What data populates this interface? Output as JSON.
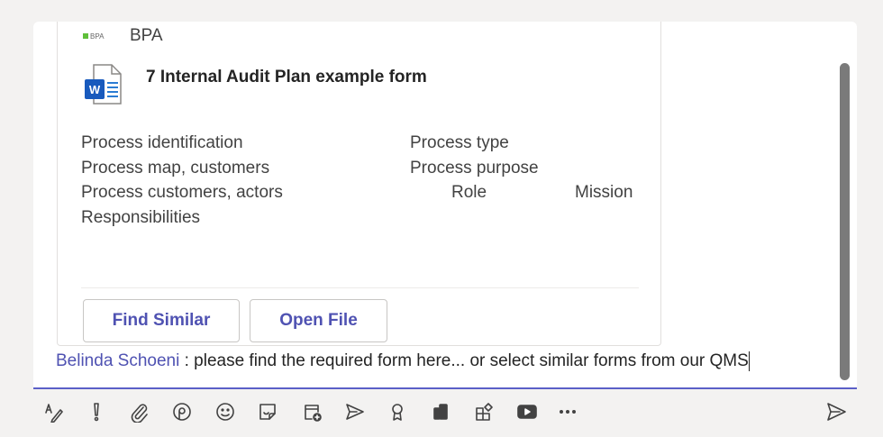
{
  "card": {
    "brand_logo_text": "BPA",
    "brand_name": "BPA",
    "document_title": "7 Internal Audit Plan example form",
    "fields": [
      "Process identification",
      "Process type",
      "Process map, customers",
      "Process purpose",
      "Process customers, actors",
      "Role",
      "Mission",
      "Responsibilities"
    ],
    "buttons": {
      "find_similar": "Find Similar",
      "open_file": "Open File"
    }
  },
  "message": {
    "mention": "Belinda Schoeni",
    "text": " : please find the required form here... or select similar forms from our QMS"
  },
  "toolbar": {
    "icons": [
      "format-icon",
      "important-icon",
      "attach-icon",
      "loop-icon",
      "emoji-icon",
      "sticker-icon",
      "schedule-meeting-icon",
      "praise-send-icon",
      "praise-icon",
      "app-icon",
      "apps-icon",
      "youtube-icon",
      "more-icon",
      "send-icon"
    ]
  },
  "colors": {
    "accent": "#5b5fc7",
    "link": "#4f52b2",
    "brand_green": "#5fbf3a"
  }
}
